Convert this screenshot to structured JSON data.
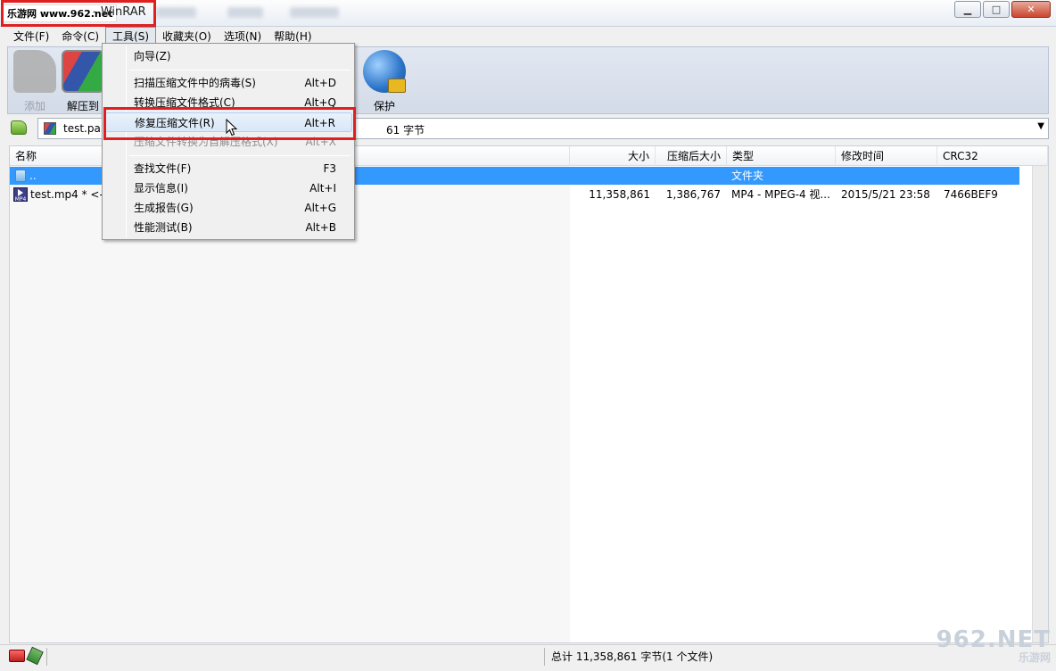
{
  "window": {
    "title": "- WinRAR",
    "watermark_tl": "乐游网 www.962.net",
    "buttons": {
      "minimize": "▁",
      "maximize": "□",
      "close": "✕"
    }
  },
  "menubar": [
    {
      "label": "文件(F)"
    },
    {
      "label": "命令(C)"
    },
    {
      "label": "工具(S)"
    },
    {
      "label": "收藏夹(O)"
    },
    {
      "label": "选项(N)"
    },
    {
      "label": "帮助(H)"
    }
  ],
  "toolbar": {
    "add_label": "添加",
    "extract_label": "解压到",
    "protect_label": "保护"
  },
  "address": {
    "path_text": "test.par",
    "tail_text": "61 字节",
    "dropdown": "▼"
  },
  "columns": {
    "name": "名称",
    "size": "大小",
    "packed": "压缩后大小",
    "type": "类型",
    "modified": "修改时间",
    "crc": "CRC32"
  },
  "files": [
    {
      "name": "..",
      "size": "",
      "packed": "",
      "type": "文件夹",
      "modified": "",
      "crc": ""
    },
    {
      "name": "test.mp4 * <--",
      "size": "11,358,861",
      "packed": "1,386,767",
      "type": "MP4 - MPEG-4 视...",
      "modified": "2015/5/21 23:58",
      "crc": "7466BEF9"
    }
  ],
  "tools_menu": {
    "items": [
      {
        "label": "向导(Z)",
        "shortcut": ""
      },
      {
        "label": "扫描压缩文件中的病毒(S)",
        "shortcut": "Alt+D"
      },
      {
        "label": "转换压缩文件格式(C)",
        "shortcut": "Alt+Q"
      },
      {
        "label": "修复压缩文件(R)",
        "shortcut": "Alt+R"
      },
      {
        "label": "压缩文件转换为自解压格式(X)",
        "shortcut": "Alt+X"
      },
      {
        "label": "查找文件(F)",
        "shortcut": "F3"
      },
      {
        "label": "显示信息(I)",
        "shortcut": "Alt+I"
      },
      {
        "label": "生成报告(G)",
        "shortcut": "Alt+G"
      },
      {
        "label": "性能测试(B)",
        "shortcut": "Alt+B"
      }
    ]
  },
  "status": {
    "summary": "总计 11,358,861 字节(1 个文件)"
  },
  "watermark_br": {
    "big": "962.NET",
    "small": "乐游网"
  },
  "colors": {
    "selection": "#3399ff",
    "highlight_box": "#e02020"
  }
}
